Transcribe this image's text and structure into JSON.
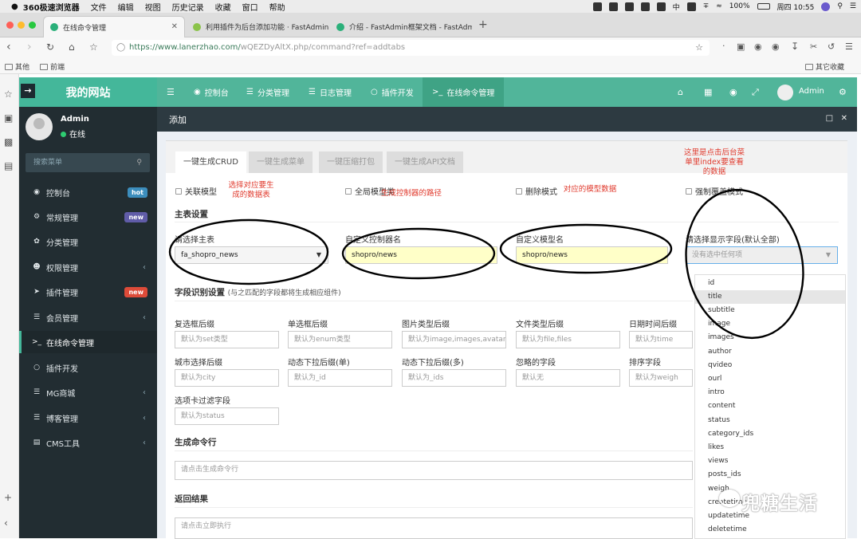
{
  "macbar": {
    "app_name": "360极速浏览器",
    "menus": [
      "文件",
      "编辑",
      "视图",
      "历史记录",
      "收藏",
      "窗口",
      "帮助"
    ],
    "input_method": "中",
    "battery": "100%",
    "clock": "周四 10:55"
  },
  "browser": {
    "tabs": [
      {
        "title": "在线命令管理",
        "active": true
      },
      {
        "title": "利用插件为后台添加功能 · FastAdmin",
        "active": false
      },
      {
        "title": "介绍 - FastAdmin框架文档 - FastAdmin",
        "active": false
      }
    ],
    "new_tab": "+",
    "url_host": "https://www.lanerzhao.com/",
    "url_path": "wQEZDyAltX.php/command?ref=addtabs",
    "bookmarks": [
      "其他",
      "前端"
    ],
    "other_bookmarks": "其它收藏"
  },
  "header": {
    "site_name": "我的网站",
    "nav": [
      "控制台",
      "分类管理",
      "日志管理",
      "插件开发",
      "在线命令管理"
    ],
    "admin_name": "Admin"
  },
  "sidebar": {
    "user_name": "Admin",
    "user_status": "在线",
    "search_placeholder": "搜索菜单",
    "items": [
      {
        "label": "控制台",
        "badge": "hot",
        "badge_color": "#3c8dbc"
      },
      {
        "label": "常规管理",
        "badge": "new",
        "badge_color": "#605ca8"
      },
      {
        "label": "分类管理"
      },
      {
        "label": "权限管理",
        "has_arrow": true
      },
      {
        "label": "插件管理",
        "badge": "new",
        "badge_color": "#dd4b39"
      },
      {
        "label": "会员管理",
        "has_arrow": true
      },
      {
        "label": "在线命令管理",
        "active": true
      },
      {
        "label": "插件开发"
      },
      {
        "label": "MG商城",
        "has_arrow": true
      },
      {
        "label": "博客管理",
        "has_arrow": true
      },
      {
        "label": "CMS工具",
        "has_arrow": true
      }
    ]
  },
  "panel": {
    "title": "添加"
  },
  "form_tabs": [
    "一键生成CRUD",
    "一键生成菜单",
    "一键压缩打包",
    "一键生成API文档"
  ],
  "checkboxes": [
    "关联模型",
    "全局模型类",
    "删除模式",
    "强制覆盖模式"
  ],
  "main_settings": {
    "heading": "主表设置",
    "table_label": "请选择主表",
    "table_value": "fa_shopro_news",
    "controller_label": "自定义控制器名",
    "controller_value": "shopro/news",
    "model_label": "自定义模型名",
    "model_value": "shopro/news",
    "fields_label": "请选择显示字段(默认全部)",
    "fields_placeholder": "没有选中任何项"
  },
  "field_detect": {
    "heading": "字段识别设置",
    "note": "(与之匹配的字段都将生成相应组件)",
    "fields": [
      {
        "label": "复选框后缀",
        "placeholder": "默认为set类型"
      },
      {
        "label": "单选框后缀",
        "placeholder": "默认为enum类型"
      },
      {
        "label": "图片类型后缀",
        "placeholder": "默认为image,images,avatar,a"
      },
      {
        "label": "文件类型后缀",
        "placeholder": "默认为file,files"
      },
      {
        "label": "日期时间后缀",
        "placeholder": "默认为time"
      },
      {
        "label": "城市选择后缀",
        "placeholder": "默认为city"
      },
      {
        "label": "动态下拉后缀(单)",
        "placeholder": "默认为_id"
      },
      {
        "label": "动态下拉后缀(多)",
        "placeholder": "默认为_ids"
      },
      {
        "label": "忽略的字段",
        "placeholder": "默认无"
      },
      {
        "label": "排序字段",
        "placeholder": "默认为weigh"
      },
      {
        "label": "选项卡过滤字段",
        "placeholder": "默认为status"
      }
    ]
  },
  "generate": {
    "heading": "生成命令行",
    "placeholder": "请点击生成命令行"
  },
  "result": {
    "heading": "返回结果",
    "placeholder": "请点击立即执行"
  },
  "dropdown_options": [
    "id",
    "title",
    "subtitle",
    "image",
    "images",
    "author",
    "qvideo",
    "ourl",
    "intro",
    "content",
    "status",
    "category_ids",
    "likes",
    "views",
    "posts_ids",
    "weigh",
    "createtime",
    "updatetime",
    "deletetime"
  ],
  "annotations": [
    "选择对应要生成的数据表",
    "生成控制器的路径",
    "对应的模型数据",
    "这里是点击后台菜单里index要查看的数据"
  ],
  "watermark": "兜糖生活",
  "colors": {
    "accent": "#51b59a",
    "sidebar": "#222d32",
    "annotation": "#e03a2d",
    "highlight_input": "#ffffc8"
  }
}
